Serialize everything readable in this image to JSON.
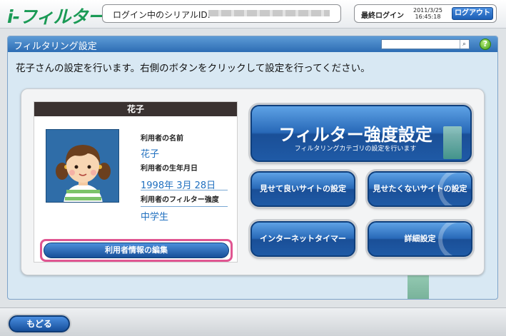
{
  "header": {
    "logo": "i-フィルター",
    "serial_label": "ログイン中のシリアルID:",
    "last_login_label": "最終ログイン",
    "last_login_date": "2011/3/25",
    "last_login_time": "16:45:18",
    "logout_label": "ログアウト"
  },
  "panel": {
    "title": "フィルタリング設定",
    "help_icon": "?",
    "instruction": "花子さんの設定を行います。右側のボタンをクリックして設定を行ってください。"
  },
  "user_card": {
    "name_header": "花子",
    "name_label": "利用者の名前",
    "name_value": "花子",
    "birth_label": "利用者の生年月日",
    "birth_value": "1998年 3月 28日",
    "strength_label": "利用者のフィルター強度",
    "strength_value": "中学生",
    "edit_button": "利用者情報の編集"
  },
  "actions": {
    "filter_strength": "フィルター強度設定",
    "filter_strength_sub": "フィルタリングカテゴリの設定を行います",
    "allowed_sites": "見せて良いサイトの設定",
    "blocked_sites": "見せたくないサイトの設定",
    "internet_timer": "インターネットタイマー",
    "detail_settings": "詳細設定"
  },
  "footer": {
    "back_label": "もどる"
  },
  "colors": {
    "brand_green": "#1a9a55",
    "panel_blue": "#2d6db4",
    "highlight_pink": "#e05591",
    "value_blue": "#1f6fbf"
  },
  "icons": [
    "search-icon",
    "help-icon",
    "avatar-girl-illustration"
  ]
}
